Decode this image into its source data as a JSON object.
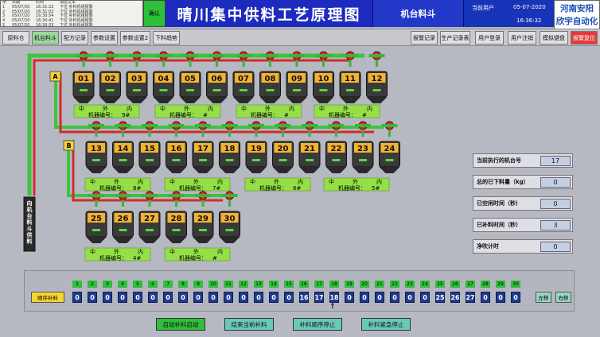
{
  "alarm_log": {
    "rows": [
      {
        "no": "序",
        "date": "日期",
        "time": "时间",
        "msg": "消息文本"
      },
      {
        "no": "1",
        "date": "05/07/20",
        "time": "16:31:22",
        "msg": "下位 补料机组报警"
      },
      {
        "no": "2",
        "date": "05/07/20",
        "time": "16:31:02",
        "msg": "下位 补料机组报警"
      },
      {
        "no": "3",
        "date": "05/07/20",
        "time": "16:30:54",
        "msg": "下位 补料机组报警"
      },
      {
        "no": "4",
        "date": "05/07/20",
        "time": "16:30:41",
        "msg": "下位 补料机组报警"
      },
      {
        "no": "5",
        "date": "05/07/20",
        "time": "16:30:33",
        "msg": "下位 补料机组报警"
      }
    ],
    "ack_label": "确认"
  },
  "header": {
    "title": "晴川集中供料工艺原理图",
    "subtitle": "机台料斗",
    "current_user_label": "当前用户",
    "date": "05-07-2020",
    "time": "16:36:32",
    "brand_line1": "河南安阳",
    "brand_line2": "欣宇自动化"
  },
  "nav": {
    "left": [
      "原料仓",
      "机台料斗",
      "配方记录",
      "参数设置",
      "参数设置2",
      "下料趋势"
    ],
    "right": [
      "报警记录",
      "生产记录表",
      "用户登录",
      "用户注销",
      "模拟键盘",
      "报警复位"
    ]
  },
  "process": {
    "line_a_label": "A",
    "line_b_label": "B",
    "left_pipe_label": "向机台料斗供料",
    "row1_tanks": [
      "01",
      "02",
      "03",
      "04",
      "05",
      "06",
      "07",
      "08",
      "09",
      "10",
      "11",
      "12"
    ],
    "row2_tanks": [
      "13",
      "14",
      "15",
      "16",
      "17",
      "18",
      "19",
      "20",
      "21",
      "22",
      "23",
      "24"
    ],
    "row3_tanks": [
      "25",
      "26",
      "27",
      "28",
      "29",
      "30"
    ],
    "machine_labels": [
      {
        "prefix": "机器编号：",
        "num": "9#"
      },
      {
        "prefix": "机器编号：",
        "num": "#"
      },
      {
        "prefix": "机器编号：",
        "num": "#"
      },
      {
        "prefix": "机器编号：",
        "num": "#"
      },
      {
        "prefix": "机器编号：",
        "num": "8#"
      },
      {
        "prefix": "机器编号：",
        "num": "7#"
      },
      {
        "prefix": "机器编号：",
        "num": "6#"
      },
      {
        "prefix": "机器编号：",
        "num": "5#"
      },
      {
        "prefix": "机器编号：",
        "num": "4#"
      },
      {
        "prefix": "机器编号：",
        "num": "#"
      }
    ],
    "mid_in_out": [
      "中",
      "外",
      "内"
    ]
  },
  "info": {
    "current_machine_label": "当前执行的机台号",
    "current_machine_value": "17",
    "total_drop_label": "总的已下料量（kg）",
    "total_drop_value": "0",
    "idle_time_label": "已空闲时间（秒）",
    "idle_time_value": "0",
    "feed_time_label": "已补料时间（秒）",
    "feed_time_value": "3",
    "purge_label": "净吹计时",
    "purge_value": "0"
  },
  "sequence": {
    "label": "顺序补料",
    "headers": [
      "1",
      "2",
      "3",
      "4",
      "5",
      "6",
      "7",
      "8",
      "9",
      "10",
      "11",
      "12",
      "13",
      "14",
      "15",
      "16",
      "17",
      "18",
      "19",
      "20",
      "21",
      "22",
      "23",
      "24",
      "25",
      "26",
      "27",
      "28",
      "29",
      "30"
    ],
    "values": [
      "0",
      "0",
      "0",
      "0",
      "0",
      "0",
      "0",
      "0",
      "0",
      "0",
      "0",
      "0",
      "0",
      "0",
      "0",
      "16",
      "17",
      "18",
      "0",
      "0",
      "0",
      "0",
      "0",
      "0",
      "25",
      "26",
      "27",
      "0",
      "0",
      "0"
    ],
    "pointer": "↑",
    "shift_left": "左移",
    "shift_right": "右移"
  },
  "actions": {
    "auto_start": "自动补料启动",
    "end_current": "结束当前补料",
    "seq_stop": "补料顺序停止",
    "emergency_stop": "补料紧急停止"
  },
  "colors": {
    "pipe_green": "#3cc63c",
    "pipe_red": "#d22b2b",
    "valve_red": "#e02b2b",
    "tank_grey": "#4a4a4a",
    "title_blue": "#1c2bbd",
    "machine_green": "#94e046"
  }
}
